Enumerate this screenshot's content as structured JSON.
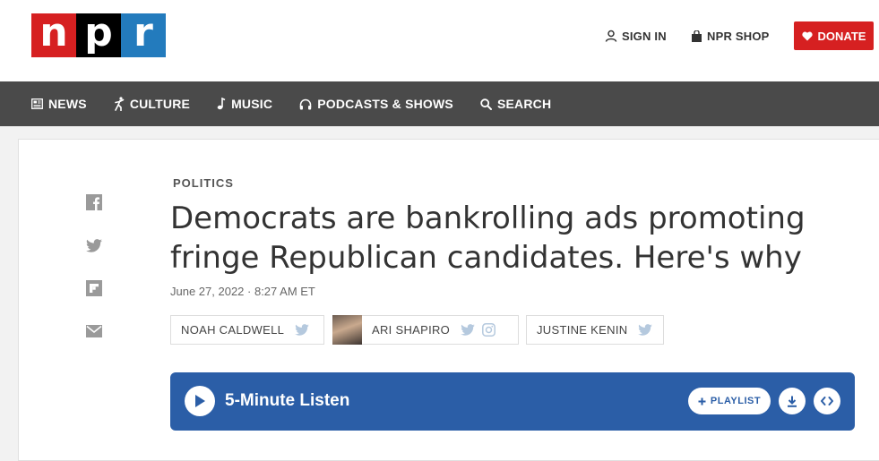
{
  "logo": {
    "n": "n",
    "p": "p",
    "r": "r"
  },
  "header": {
    "sign_in": "SIGN IN",
    "shop": "NPR SHOP",
    "donate": "DONATE"
  },
  "nav": {
    "news": "NEWS",
    "culture": "CULTURE",
    "music": "MUSIC",
    "podcasts": "PODCASTS & SHOWS",
    "search": "SEARCH"
  },
  "article": {
    "section": "POLITICS",
    "headline": "Democrats are bankrolling ads promoting fringe Republican candidates. Here's why",
    "date": "June 27, 2022 · 8:27 AM ET",
    "bylines": [
      "NOAH CALDWELL",
      "ARI SHAPIRO",
      "JUSTINE KENIN"
    ]
  },
  "player": {
    "label": "5-Minute Listen",
    "playlist": "PLAYLIST"
  },
  "colors": {
    "npr_red": "#d62021",
    "npr_blue": "#237bbd",
    "nav_bg": "#4a4a4a",
    "player_bg": "#2b5ea7"
  }
}
